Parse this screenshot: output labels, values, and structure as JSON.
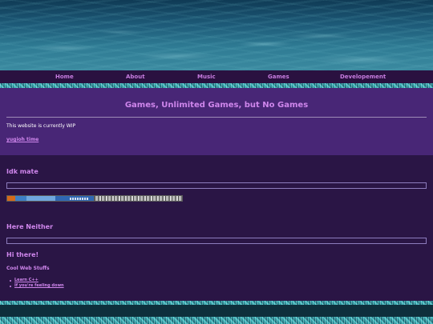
{
  "nav": {
    "items": [
      {
        "label": "Home"
      },
      {
        "label": "About"
      },
      {
        "label": "Music"
      },
      {
        "label": "Games"
      },
      {
        "label": "Developement"
      }
    ]
  },
  "hero": {
    "title": "Games, Unlimited Games, but No Games",
    "text": "This website is currently WIP",
    "link": "yugioh time"
  },
  "sections": {
    "idk": {
      "title": "Idk mate"
    },
    "neither": {
      "title": "Here Neither"
    },
    "hi": {
      "title": "Hi there!"
    }
  },
  "cool": {
    "heading": "Cool Web Stuffs",
    "links": [
      "Learn C++",
      "If you're feeling down"
    ]
  },
  "colors": {
    "accent": "#cf86ec",
    "page_bg": "#2a1545",
    "hero_bg": "#482676",
    "navbar_bg": "#2a1140"
  },
  "decor": {
    "badges": [
      "web-badge",
      "web-badge"
    ]
  }
}
